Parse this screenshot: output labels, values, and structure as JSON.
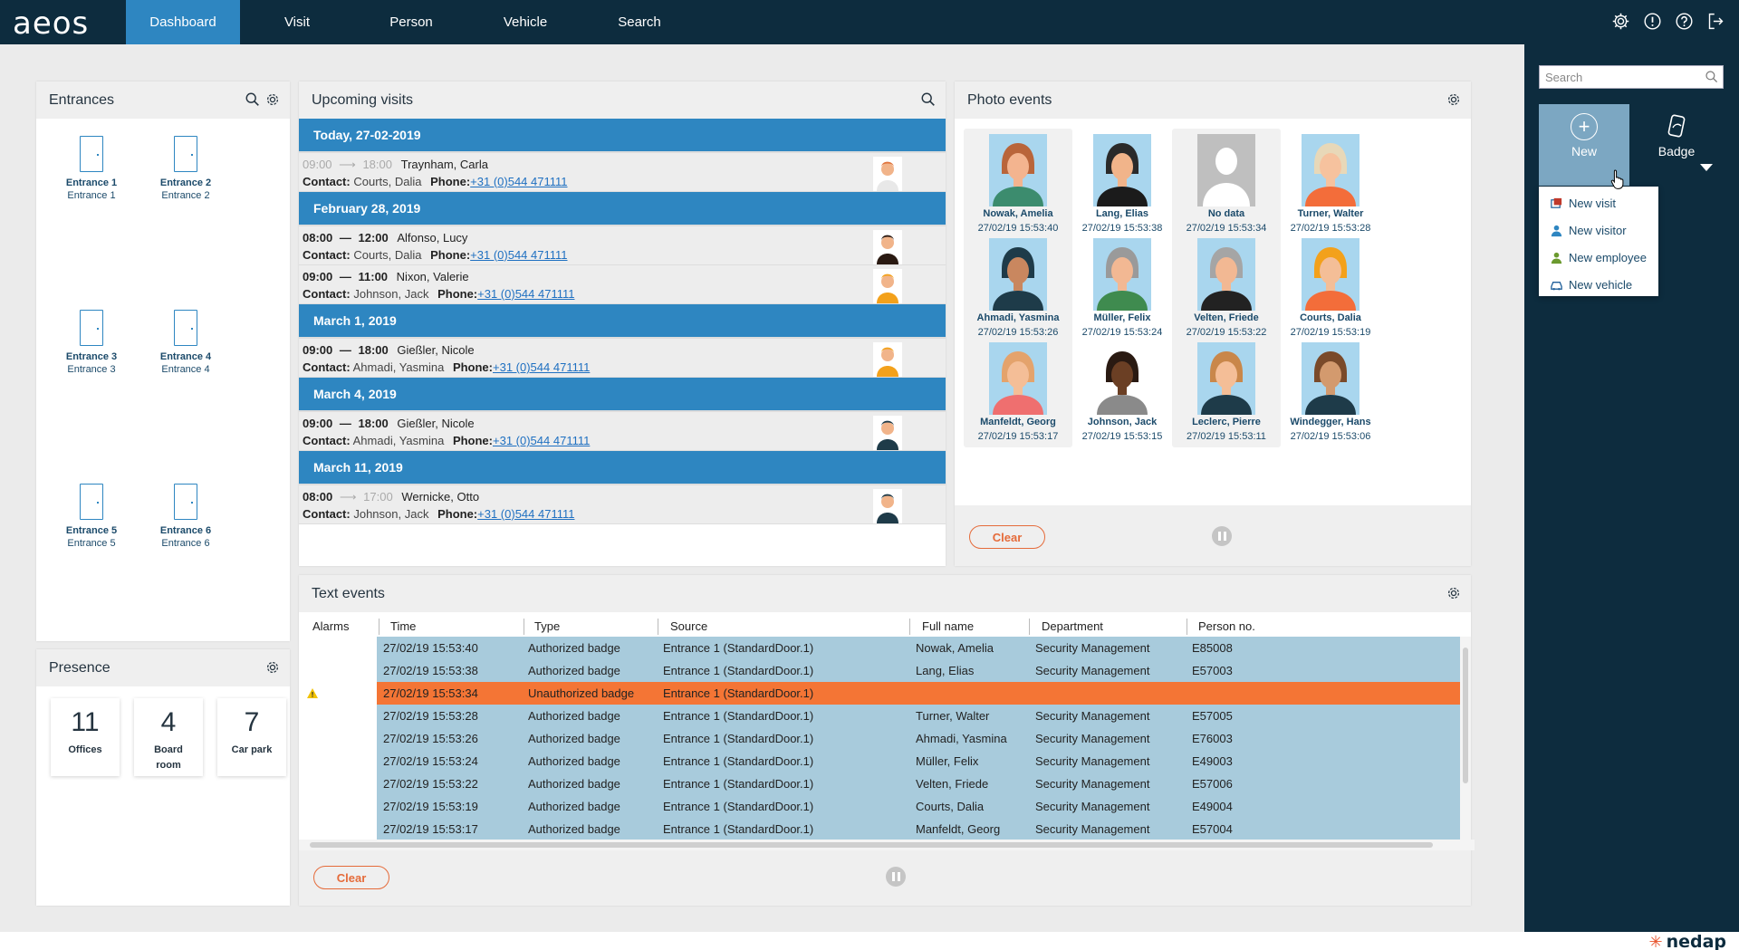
{
  "app": {
    "logo": "aeos"
  },
  "nav": {
    "items": [
      {
        "label": "Dashboard",
        "active": true
      },
      {
        "label": "Visit"
      },
      {
        "label": "Person"
      },
      {
        "label": "Vehicle"
      },
      {
        "label": "Search"
      }
    ]
  },
  "top_icons": [
    "gear-icon",
    "alert-icon",
    "help-icon",
    "logout-icon"
  ],
  "entrances": {
    "title": "Entrances",
    "items": [
      {
        "name": "Entrance 1",
        "sub": "Entrance 1"
      },
      {
        "name": "Entrance 2",
        "sub": "Entrance 2"
      },
      {
        "name": "Entrance 3",
        "sub": "Entrance 3"
      },
      {
        "name": "Entrance 4",
        "sub": "Entrance 4"
      },
      {
        "name": "Entrance 5",
        "sub": "Entrance 5"
      },
      {
        "name": "Entrance 6",
        "sub": "Entrance 6"
      }
    ]
  },
  "presence": {
    "title": "Presence",
    "tiles": [
      {
        "count": "11",
        "label": "Offices"
      },
      {
        "count": "4",
        "label": "Board room"
      },
      {
        "count": "7",
        "label": "Car park"
      }
    ]
  },
  "upcoming": {
    "title": "Upcoming visits",
    "contact_label": "Contact:",
    "phone_label": "Phone:",
    "groups": [
      {
        "date": "Today, 27-02-2019",
        "visits": [
          {
            "start": "09:00",
            "end": "18:00",
            "sep": "⟶",
            "muted": true,
            "name": "Traynham, Carla",
            "contact": "Courts, Dalia",
            "phone": "+31 (0)544 471111"
          }
        ]
      },
      {
        "date": "February 28, 2019",
        "visits": [
          {
            "start": "08:00",
            "end": "12:00",
            "sep": "—",
            "muted": false,
            "name": "Alfonso, Lucy",
            "contact": "Courts, Dalia",
            "phone": "+31 (0)544 471111"
          },
          {
            "start": "09:00",
            "end": "11:00",
            "sep": "—",
            "muted": false,
            "name": "Nixon, Valerie",
            "contact": "Johnson, Jack",
            "phone": "+31 (0)544 471111"
          }
        ]
      },
      {
        "date": "March 1, 2019",
        "visits": [
          {
            "start": "09:00",
            "end": "18:00",
            "sep": "—",
            "muted": false,
            "name": "Gießler, Nicole",
            "contact": "Ahmadi, Yasmina",
            "phone": "+31 (0)544 471111"
          }
        ]
      },
      {
        "date": "March 4, 2019",
        "visits": [
          {
            "start": "09:00",
            "end": "18:00",
            "sep": "—",
            "muted": false,
            "name": "Gießler, Nicole",
            "contact": "Ahmadi, Yasmina",
            "phone": "+31 (0)544 471111"
          }
        ]
      },
      {
        "date": "March 11, 2019",
        "visits": [
          {
            "start": "08:00",
            "end": "17:00",
            "sep": "⟶",
            "muted": "end",
            "name": "Wernicke, Otto",
            "contact": "Johnson, Jack",
            "phone": "+31 (0)544 471111"
          }
        ]
      }
    ]
  },
  "photo_events": {
    "title": "Photo events",
    "clear_label": "Clear",
    "items": [
      {
        "name": "Nowak, Amelia",
        "time": "27/02/19 15:53:40",
        "hair": "#b9653a",
        "skin": "#f3b48f",
        "shirt": "#3c8c6e",
        "bg": "#a9d6ee",
        "card": true
      },
      {
        "name": "Lang, Elias",
        "time": "27/02/19 15:53:38",
        "hair": "#2a2a2a",
        "skin": "#f1b48a",
        "shirt": "#1b1b1b",
        "bg": "#a9d6ee",
        "card": false
      },
      {
        "name": "No data",
        "time": "27/02/19 15:53:34",
        "hair": "#ffffff",
        "skin": "#ffffff",
        "shirt": "#ffffff",
        "bg": "#bfbfbf",
        "card": true,
        "nodata": true
      },
      {
        "name": "Turner, Walter",
        "time": "27/02/19 15:53:28",
        "hair": "#e8d8b8",
        "skin": "#f6c29e",
        "shirt": "#f36d3a",
        "bg": "#a9d6ee",
        "card": false
      },
      {
        "name": "Ahmadi, Yasmina",
        "time": "27/02/19 15:53:26",
        "hair": "#1e3b49",
        "skin": "#c9875f",
        "shirt": "#1e3b49",
        "bg": "#a9d6ee",
        "card": true
      },
      {
        "name": "Müller, Felix",
        "time": "27/02/19 15:53:24",
        "hair": "#9a9a9a",
        "skin": "#f2b893",
        "shirt": "#3f8b4f",
        "bg": "#a9d6ee",
        "card": false
      },
      {
        "name": "Velten, Friede",
        "time": "27/02/19 15:53:22",
        "hair": "#a5a5a5",
        "skin": "#f2b893",
        "shirt": "#222222",
        "bg": "#a9d6ee",
        "card": true
      },
      {
        "name": "Courts, Dalia",
        "time": "27/02/19 15:53:19",
        "hair": "#f3a11b",
        "skin": "#f4be97",
        "shirt": "#f36d3a",
        "bg": "#a9d6ee",
        "card": false
      },
      {
        "name": "Manfeldt, Georg",
        "time": "27/02/19 15:53:17",
        "hair": "#e4a36c",
        "skin": "#f4be97",
        "shirt": "#ef6f6f",
        "bg": "#a9d6ee",
        "card": true
      },
      {
        "name": "Johnson, Jack",
        "time": "27/02/19 15:53:15",
        "hair": "#2a1a12",
        "skin": "#6b3f24",
        "shirt": "#8a8a8a",
        "bg": "#ffffff",
        "card": false
      },
      {
        "name": "Leclerc, Pierre",
        "time": "27/02/19 15:53:11",
        "hair": "#c9874a",
        "skin": "#f4be97",
        "shirt": "#1e3b49",
        "bg": "#a9d6ee",
        "card": true
      },
      {
        "name": "Windegger, Hans",
        "time": "27/02/19 15:53:06",
        "hair": "#7a4a2a",
        "skin": "#d39a6e",
        "shirt": "#1e3b49",
        "bg": "#a9d6ee",
        "card": false
      }
    ]
  },
  "text_events": {
    "title": "Text events",
    "clear_label": "Clear",
    "columns": [
      "Alarms",
      "Time",
      "Type",
      "Source",
      "Full name",
      "Department",
      "Person no."
    ],
    "rows": [
      {
        "alarm": false,
        "time": "27/02/19 15:53:40",
        "type": "Authorized badge",
        "source": "Entrance 1 (StandardDoor.1)",
        "name": "Nowak, Amelia",
        "dept": "Security Management",
        "pno": "E85008"
      },
      {
        "alarm": false,
        "time": "27/02/19 15:53:38",
        "type": "Authorized badge",
        "source": "Entrance 1 (StandardDoor.1)",
        "name": "Lang, Elias",
        "dept": "Security Management",
        "pno": "E57003"
      },
      {
        "alarm": true,
        "time": "27/02/19 15:53:34",
        "type": "Unauthorized badge",
        "source": "Entrance 1 (StandardDoor.1)",
        "name": "",
        "dept": "",
        "pno": ""
      },
      {
        "alarm": false,
        "time": "27/02/19 15:53:28",
        "type": "Authorized badge",
        "source": "Entrance 1 (StandardDoor.1)",
        "name": "Turner, Walter",
        "dept": "Security Management",
        "pno": "E57005"
      },
      {
        "alarm": false,
        "time": "27/02/19 15:53:26",
        "type": "Authorized badge",
        "source": "Entrance 1 (StandardDoor.1)",
        "name": "Ahmadi, Yasmina",
        "dept": "Security Management",
        "pno": "E76003"
      },
      {
        "alarm": false,
        "time": "27/02/19 15:53:24",
        "type": "Authorized badge",
        "source": "Entrance 1 (StandardDoor.1)",
        "name": "Müller, Felix",
        "dept": "Security Management",
        "pno": "E49003"
      },
      {
        "alarm": false,
        "time": "27/02/19 15:53:22",
        "type": "Authorized badge",
        "source": "Entrance 1 (StandardDoor.1)",
        "name": "Velten, Friede",
        "dept": "Security Management",
        "pno": "E57006"
      },
      {
        "alarm": false,
        "time": "27/02/19 15:53:19",
        "type": "Authorized badge",
        "source": "Entrance 1 (StandardDoor.1)",
        "name": "Courts, Dalia",
        "dept": "Security Management",
        "pno": "E49004"
      },
      {
        "alarm": false,
        "time": "27/02/19 15:53:17",
        "type": "Authorized badge",
        "source": "Entrance 1 (StandardDoor.1)",
        "name": "Manfeldt, Georg",
        "dept": "Security Management",
        "pno": "E57004"
      }
    ]
  },
  "sidebar": {
    "search_placeholder": "Search",
    "new_label": "New",
    "badge_label": "Badge",
    "menu": [
      {
        "label": "New visit",
        "icon": "visit-icon",
        "color": "#c0392b"
      },
      {
        "label": "New visitor",
        "icon": "visitor-icon",
        "color": "#2e86c1"
      },
      {
        "label": "New employee",
        "icon": "employee-icon",
        "color": "#6b9a2e"
      },
      {
        "label": "New vehicle",
        "icon": "vehicle-icon",
        "color": "#1f5f9a"
      }
    ]
  },
  "footer": {
    "brand": "nedap"
  },
  "colors": {
    "topbar": "#0d2c3e",
    "accent": "#2e86c1",
    "alarm": "#f47535",
    "row": "#a8cbdc"
  }
}
